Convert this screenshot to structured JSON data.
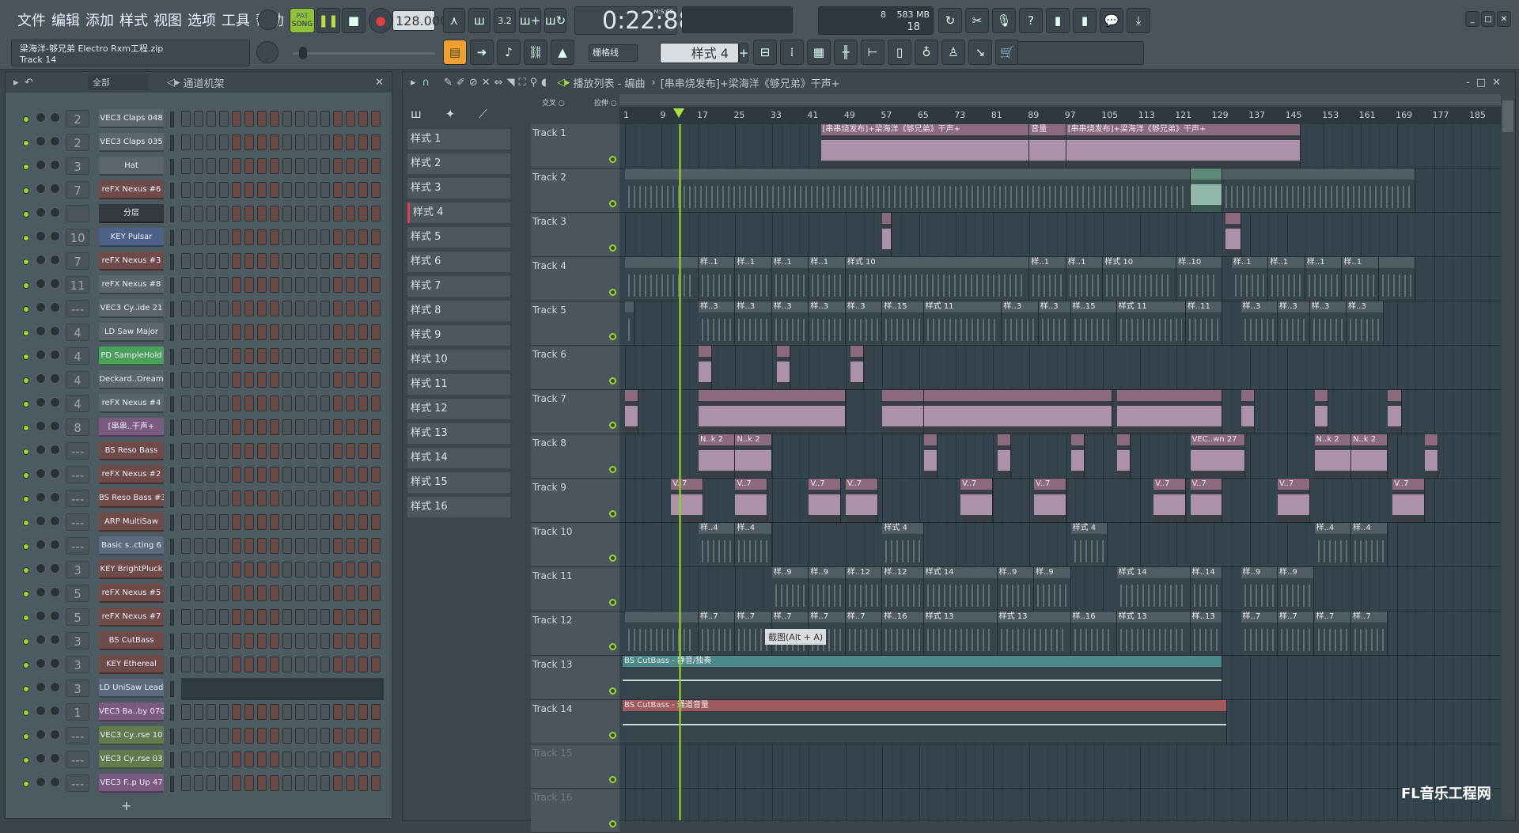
{
  "menu": [
    "文件",
    "编辑",
    "添加",
    "样式",
    "视图",
    "选项",
    "工具",
    "帮助"
  ],
  "transport": {
    "pat": "PAT",
    "song": "SONG",
    "tempo": "128.000",
    "time": "0:22:88",
    "time_unit": "M:S:CS",
    "cpu": "8",
    "memory": "583 MB",
    "polyphony": "18"
  },
  "hint": {
    "project": "梁海洋-够兄弟 Electro Rxm工程.zip",
    "item": "Track 14"
  },
  "snap": "栅格线",
  "pattern_selector": "样式 4",
  "rack": {
    "filter": "全部",
    "title": "通道机架",
    "add": "+",
    "channels": [
      {
        "name": "VEC3 Claps 048",
        "route": "2",
        "color": "#5b666c"
      },
      {
        "name": "VEC3 Claps 035",
        "route": "2",
        "color": "#5b666c"
      },
      {
        "name": "Hat",
        "route": "3",
        "color": "#5b666c"
      },
      {
        "name": "reFX Nexus #6",
        "route": "7",
        "color": "#6e4a48"
      },
      {
        "name": "分层",
        "route": "",
        "color": "#33393d"
      },
      {
        "name": "KEY Pulsar",
        "route": "10",
        "color": "#4d6088"
      },
      {
        "name": "reFX Nexus #3",
        "route": "7",
        "color": "#6e4a48"
      },
      {
        "name": "reFX Nexus #8",
        "route": "11",
        "color": "#5b666c"
      },
      {
        "name": "VEC3 Cy..ide 21",
        "route": "---",
        "color": "#5b666c"
      },
      {
        "name": "LD Saw Major",
        "route": "4",
        "color": "#5b666c"
      },
      {
        "name": "PD SampleHold",
        "route": "4",
        "color": "#4aa05a"
      },
      {
        "name": "Deckard..Dream",
        "route": "4",
        "color": "#5b666c"
      },
      {
        "name": "reFX Nexus #4",
        "route": "4",
        "color": "#5b666c"
      },
      {
        "name": "[串串..干声+",
        "route": "8",
        "color": "#7a5a80"
      },
      {
        "name": "BS Reso Bass",
        "route": "---",
        "color": "#6e4a48"
      },
      {
        "name": "reFX Nexus #2",
        "route": "---",
        "color": "#6e4a48"
      },
      {
        "name": "BS Reso Bass #3",
        "route": "---",
        "color": "#6e4a48"
      },
      {
        "name": "ARP MultiSaw",
        "route": "---",
        "color": "#6e4a48"
      },
      {
        "name": "Basic s..cting 6",
        "route": "---",
        "color": "#5d6a7e"
      },
      {
        "name": "KEY BrightPluck",
        "route": "3",
        "color": "#6e4a48"
      },
      {
        "name": "reFX Nexus #5",
        "route": "5",
        "color": "#6e4a48"
      },
      {
        "name": "reFX Nexus #7",
        "route": "5",
        "color": "#6e4a48"
      },
      {
        "name": "BS CutBass",
        "route": "3",
        "color": "#6e4a48"
      },
      {
        "name": "KEY Ethereal",
        "route": "3",
        "color": "#6e4a48"
      },
      {
        "name": "LD UniSaw Lead",
        "route": "3",
        "color": "#5d6a7e",
        "piano_roll": true
      },
      {
        "name": "VEC3 Ba..by 070",
        "route": "1",
        "color": "#7a5a80"
      },
      {
        "name": "VEC3 Cy..rse 10",
        "route": "---",
        "color": "#637a4e"
      },
      {
        "name": "VEC3 Cy..rse 03",
        "route": "---",
        "color": "#637a4e"
      },
      {
        "name": "VEC3 F..p Up 47",
        "route": "---",
        "color": "#7a5a80"
      }
    ]
  },
  "playlist": {
    "title": "播放列表 - 编曲",
    "selected_clip": "[串串烧发布]+梁海洋《够兄弟》干声+",
    "crossfade": "交叉",
    "stretch": "拉伸",
    "patterns": [
      "样式 1",
      "样式 2",
      "样式 3",
      "样式 4",
      "样式 5",
      "样式 6",
      "样式 7",
      "样式 8",
      "样式 9",
      "样式 10",
      "样式 11",
      "样式 12",
      "样式 13",
      "样式 14",
      "样式 15",
      "样式 16"
    ],
    "current_pattern": 3,
    "ruler": [
      1,
      9,
      17,
      25,
      33,
      41,
      49,
      57,
      65,
      73,
      81,
      89,
      97,
      105,
      113,
      121,
      129,
      137,
      145,
      153,
      161,
      169,
      177,
      185
    ],
    "playhead_bar": 12.7,
    "colors": {
      "audio": "#8a6a7c",
      "pattern": "#4f5c64",
      "green": "#5f8a78",
      "auto-teal": "#4a8a88",
      "auto-red": "#a05a5c"
    },
    "tracks": [
      {
        "name": "Track 1",
        "clips": [
          [
            43.6,
            89,
            "[串串烧发布]+梁海洋《够兄弟》干声+",
            "audio"
          ],
          [
            89,
            97,
            "音量",
            "audio"
          ],
          [
            97,
            148,
            "[串串烧发布]+梁海洋《够兄弟》干声+",
            "audio"
          ]
        ]
      },
      {
        "name": "Track 2",
        "clips": [
          [
            1,
            124,
            "",
            "pattern"
          ],
          [
            124,
            131,
            "",
            "green"
          ],
          [
            131,
            173,
            "",
            "pattern"
          ]
        ]
      },
      {
        "name": "Track 3",
        "clips": [
          [
            57,
            59,
            "",
            "audio"
          ],
          [
            131.7,
            135,
            "",
            "audio"
          ]
        ]
      },
      {
        "name": "Track 4",
        "clips": [
          [
            1,
            17,
            "",
            "pattern"
          ],
          [
            17,
            25,
            "样..1",
            "pattern"
          ],
          [
            25,
            33,
            "样..1",
            "pattern"
          ],
          [
            33,
            41,
            "样..1",
            "pattern"
          ],
          [
            41,
            49,
            "样..1",
            "pattern"
          ],
          [
            49,
            89,
            "样式 10",
            "pattern"
          ],
          [
            89,
            97,
            "样..1",
            "pattern"
          ],
          [
            97,
            105,
            "样..1",
            "pattern"
          ],
          [
            105,
            121,
            "样式 10",
            "pattern"
          ],
          [
            121,
            131,
            "样..10",
            "pattern"
          ],
          [
            133,
            141,
            "样..1",
            "pattern"
          ],
          [
            141,
            149,
            "样..1",
            "pattern"
          ],
          [
            149,
            157,
            "样..1",
            "pattern"
          ],
          [
            157,
            165,
            "样..1",
            "pattern"
          ],
          [
            165,
            173,
            "",
            "pattern"
          ]
        ]
      },
      {
        "name": "Track 5",
        "clips": [
          [
            1,
            3,
            "",
            "pattern"
          ],
          [
            17,
            25,
            "样..3",
            "pattern"
          ],
          [
            25,
            33,
            "样..3",
            "pattern"
          ],
          [
            33,
            41,
            "样..3",
            "pattern"
          ],
          [
            41,
            49,
            "样..3",
            "pattern"
          ],
          [
            49,
            57,
            "样..3",
            "pattern"
          ],
          [
            57,
            66,
            "样..15",
            "pattern"
          ],
          [
            66,
            83,
            "样式 11",
            "pattern"
          ],
          [
            83,
            91,
            "样..3",
            "pattern"
          ],
          [
            91,
            98,
            "样..3",
            "pattern"
          ],
          [
            98,
            108,
            "样..15",
            "pattern"
          ],
          [
            108,
            123,
            "样式 11",
            "pattern"
          ],
          [
            123,
            131,
            "样..11",
            "pattern"
          ],
          [
            135,
            143,
            "样..3",
            "pattern"
          ],
          [
            143,
            150,
            "样..3",
            "pattern"
          ],
          [
            150,
            158,
            "样..3",
            "pattern"
          ],
          [
            158,
            166,
            "样..3",
            "pattern"
          ]
        ]
      },
      {
        "name": "Track 6",
        "clips": [
          [
            17,
            20,
            "",
            "audio"
          ],
          [
            34,
            37,
            "",
            "audio"
          ],
          [
            50,
            53,
            "",
            "audio"
          ]
        ]
      },
      {
        "name": "Track 7",
        "clips": [
          [
            1,
            4,
            "",
            "audio"
          ],
          [
            17,
            49,
            "",
            "audio"
          ],
          [
            57,
            66,
            "",
            "audio"
          ],
          [
            66,
            107,
            "",
            "audio"
          ],
          [
            108,
            131,
            "",
            "audio"
          ],
          [
            135,
            138,
            "",
            "audio"
          ],
          [
            151,
            154,
            "",
            "audio"
          ],
          [
            167,
            170,
            "",
            "audio"
          ]
        ]
      },
      {
        "name": "Track 8",
        "clips": [
          [
            17,
            25,
            "N..k 2",
            "audio"
          ],
          [
            25,
            33,
            "N..k 2",
            "audio"
          ],
          [
            66,
            69,
            "",
            "audio"
          ],
          [
            82,
            85,
            "",
            "audio"
          ],
          [
            98,
            101,
            "",
            "audio"
          ],
          [
            108,
            111,
            "",
            "audio"
          ],
          [
            124,
            136,
            "VEC..wn 27",
            "audio"
          ],
          [
            151,
            159,
            "N..k 2",
            "audio"
          ],
          [
            159,
            167,
            "N..k 2",
            "audio"
          ],
          [
            175,
            178,
            "",
            "audio"
          ]
        ]
      },
      {
        "name": "Track 9",
        "clips": [
          [
            11,
            18,
            "V..7",
            "audio"
          ],
          [
            25,
            32,
            "V..7",
            "audio"
          ],
          [
            41,
            48,
            "V..7",
            "audio"
          ],
          [
            49,
            56,
            "V..7",
            "audio"
          ],
          [
            74,
            81,
            "V..7",
            "audio"
          ],
          [
            90,
            97,
            "V..7",
            "audio"
          ],
          [
            116,
            123,
            "V..7",
            "audio"
          ],
          [
            124,
            131,
            "V..7",
            "audio"
          ],
          [
            143,
            150,
            "V..7",
            "audio"
          ],
          [
            168,
            175,
            "V..7",
            "audio"
          ]
        ]
      },
      {
        "name": "Track 10",
        "clips": [
          [
            17,
            25,
            "样..4",
            "pattern"
          ],
          [
            25,
            33,
            "样..4",
            "pattern"
          ],
          [
            57,
            66,
            "样式 4",
            "pattern"
          ],
          [
            98,
            106,
            "样式 4",
            "pattern"
          ],
          [
            151,
            159,
            "样..4",
            "pattern"
          ],
          [
            159,
            167,
            "样..4",
            "pattern"
          ]
        ]
      },
      {
        "name": "Track 11",
        "clips": [
          [
            33,
            41,
            "样..9",
            "pattern"
          ],
          [
            41,
            49,
            "样..9",
            "pattern"
          ],
          [
            49,
            57,
            "样..12",
            "pattern"
          ],
          [
            57,
            66,
            "样..12",
            "pattern"
          ],
          [
            66,
            82,
            "样式 14",
            "pattern"
          ],
          [
            82,
            90,
            "样..9",
            "pattern"
          ],
          [
            90,
            98,
            "样..9",
            "pattern"
          ],
          [
            108,
            124,
            "样式 14",
            "pattern"
          ],
          [
            124,
            131,
            "样..14",
            "pattern"
          ],
          [
            135,
            143,
            "样..9",
            "pattern"
          ],
          [
            143,
            151,
            "样..9",
            "pattern"
          ]
        ]
      },
      {
        "name": "Track 12",
        "clips": [
          [
            1,
            17,
            "",
            "pattern"
          ],
          [
            17,
            25,
            "样..7",
            "pattern"
          ],
          [
            25,
            33,
            "样..7",
            "pattern"
          ],
          [
            33,
            41,
            "样..7",
            "pattern"
          ],
          [
            41,
            49,
            "样..7",
            "pattern"
          ],
          [
            49,
            57,
            "样..7",
            "pattern"
          ],
          [
            57,
            66,
            "样..16",
            "pattern"
          ],
          [
            66,
            82,
            "样式 13",
            "pattern"
          ],
          [
            82,
            98,
            "样式 13",
            "pattern"
          ],
          [
            98,
            108,
            "样..16",
            "pattern"
          ],
          [
            108,
            124,
            "样式 13",
            "pattern"
          ],
          [
            124,
            131,
            "样..13",
            "pattern"
          ],
          [
            135,
            143,
            "样..7",
            "pattern"
          ],
          [
            143,
            151,
            "样..7",
            "pattern"
          ],
          [
            151,
            159,
            "样..7",
            "pattern"
          ],
          [
            159,
            167,
            "样..7",
            "pattern"
          ]
        ]
      },
      {
        "name": "Track 13",
        "clips": [
          [
            0.5,
            131,
            "BS CutBass - 静音/独奏",
            "auto-teal"
          ]
        ]
      },
      {
        "name": "Track 14",
        "clips": [
          [
            0.5,
            132,
            "BS CutBass - 通道音量",
            "auto-red"
          ]
        ]
      },
      {
        "name": "Track 15",
        "clips": []
      },
      {
        "name": "Track 16",
        "clips": []
      }
    ]
  },
  "tooltip": "截图(Alt + A)",
  "watermark": "FL音乐工程网"
}
